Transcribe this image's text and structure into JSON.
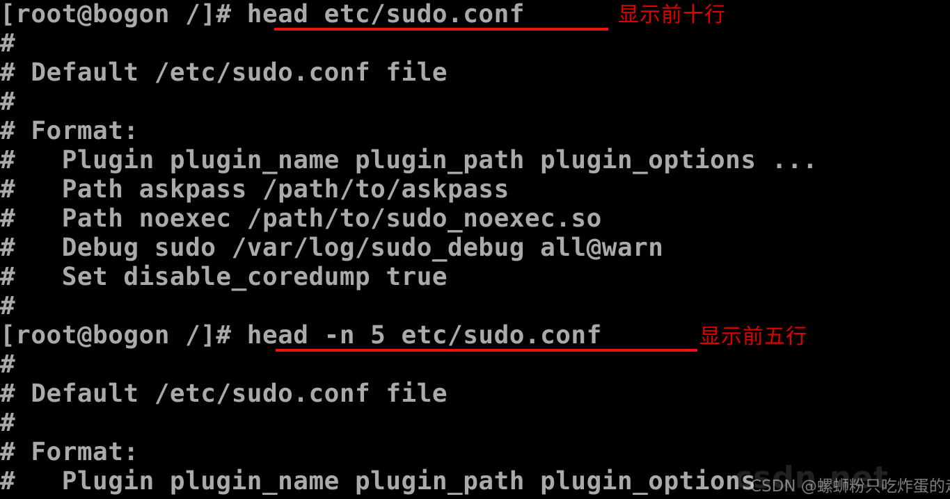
{
  "terminal": {
    "background_color": "#000000",
    "foreground_color": "#aaaaaa",
    "annotation_color": "#e00000",
    "lines": [
      {
        "text": "[root@bogon /]# head etc/sudo.conf"
      },
      {
        "text": "#"
      },
      {
        "text": "# Default /etc/sudo.conf file"
      },
      {
        "text": "#"
      },
      {
        "text": "# Format:"
      },
      {
        "text": "#   Plugin plugin_name plugin_path plugin_options ..."
      },
      {
        "text": "#   Path askpass /path/to/askpass"
      },
      {
        "text": "#   Path noexec /path/to/sudo_noexec.so"
      },
      {
        "text": "#   Debug sudo /var/log/sudo_debug all@warn"
      },
      {
        "text": "#   Set disable_coredump true"
      },
      {
        "text": "#"
      },
      {
        "text": "[root@bogon /]# head -n 5 etc/sudo.conf"
      },
      {
        "text": "#"
      },
      {
        "text": "# Default /etc/sudo.conf file"
      },
      {
        "text": "#"
      },
      {
        "text": "# Format:"
      },
      {
        "text": "#   Plugin plugin_name plugin_path plugin_options"
      }
    ]
  },
  "annotations": [
    {
      "text": "显示前十行"
    },
    {
      "text": "显示前五行"
    }
  ],
  "watermark": {
    "text": "CSDN @螺蛳粉只吃炸蛋的走风",
    "ghost_text": "csdn.net"
  }
}
